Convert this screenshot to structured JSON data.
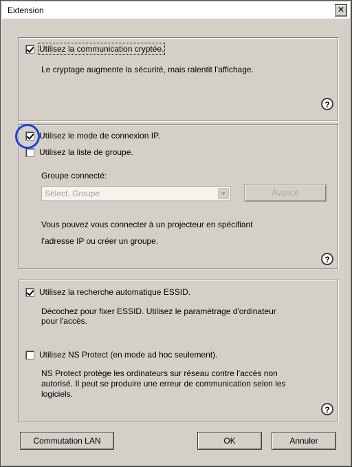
{
  "window": {
    "title": "Extension",
    "close_glyph": "✕"
  },
  "encrypt": {
    "checkbox_label": "Utilisez la communication cryptée.",
    "checked": true,
    "description": "Le cryptage augmente la sécurité, mais ralentit l'affichage.",
    "help_glyph": "?"
  },
  "ip": {
    "ip_mode_label": "Utilisez le mode de connexion IP.",
    "ip_mode_checked": true,
    "group_list_label": "Utilisez la liste de groupe.",
    "group_list_checked": false,
    "connected_group_label": "Groupe connecté:",
    "group_select_value": "Sélect. Groupe",
    "advanced_button": "Avancé",
    "description_line1": "Vous pouvez vous connecter à un projecteur en spécifiant",
    "description_line2": "l'adresse IP ou créer un groupe.",
    "help_glyph": "?"
  },
  "essid": {
    "auto_label": "Utilisez la recherche automatique ESSID.",
    "auto_checked": true,
    "auto_desc_line1": "Décochez pour fixer ESSID. Utilisez le paramétrage d'ordinateur",
    "auto_desc_line2": "pour l'accès.",
    "ns_label": "Utilisez NS Protect (en mode ad hoc seulement).",
    "ns_checked": false,
    "ns_desc_line1": "NS Protect protège les ordinateurs sur réseau contre l'accès non",
    "ns_desc_line2": "autorisé. Il peut se produire une erreur de communication selon les",
    "ns_desc_line3": "logiciels.",
    "help_glyph": "?"
  },
  "buttons": {
    "lan": "Commutation LAN",
    "ok": "OK",
    "cancel": "Annuler"
  },
  "colors": {
    "annotation_circle": "#1f3fd9",
    "dialog_face": "#d4d0c8"
  }
}
